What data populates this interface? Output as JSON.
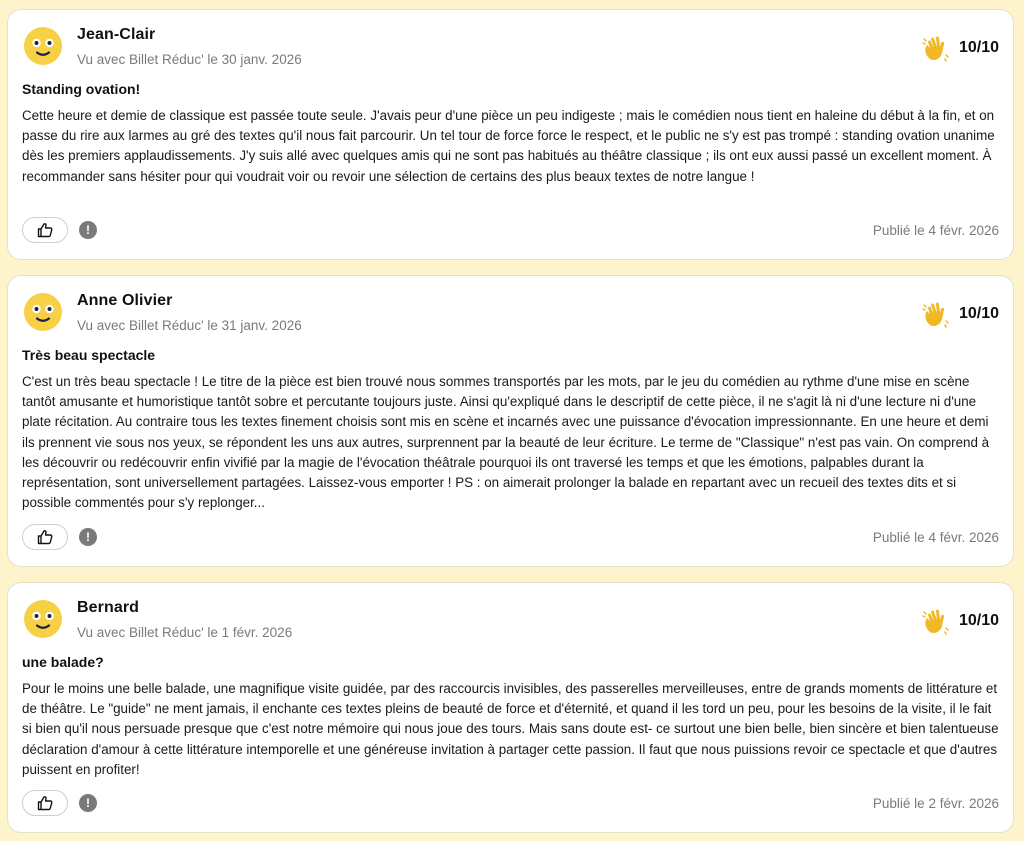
{
  "reviews": [
    {
      "name": "Jean-Clair",
      "meta": "Vu avec Billet Réduc' le 30 janv. 2026",
      "score": "10/10",
      "title": "Standing ovation!",
      "body": "Cette heure et demie de classique est passée toute seule. J'avais peur d'une pièce un peu indigeste ; mais le comédien nous tient en haleine du début à la fin, et on passe du rire aux larmes au gré des textes qu'il nous fait parcourir. Un tel tour de force force le respect, et le public ne s'y est pas trompé : standing ovation unanime dès les premiers applaudissements. J'y suis allé avec quelques amis qui ne sont pas habitués au théâtre classique ; ils ont eux aussi passé un excellent moment. À recommander sans hésiter pour qui voudrait voir ou revoir une sélection de certains des plus beaux textes de notre langue !",
      "published": "Publié le 4 févr. 2026"
    },
    {
      "name": "Anne Olivier",
      "meta": "Vu avec Billet Réduc' le 31 janv. 2026",
      "score": "10/10",
      "title": "Très beau spectacle",
      "body": "C'est un très beau spectacle ! Le titre de la pièce est bien trouvé nous sommes transportés par les mots, par le jeu du comédien au rythme d'une mise en scène tantôt amusante et humoristique tantôt sobre et percutante toujours juste. Ainsi qu'expliqué dans le descriptif de cette pièce, il ne s'agit là ni d'une lecture ni d'une plate récitation. Au contraire tous les textes finement choisis sont mis en scène et incarnés avec une puissance d'évocation impressionnante. En une heure et demi ils prennent vie sous nos yeux, se répondent les uns aux autres, surprennent par la beauté de leur écriture. Le terme de \"Classique\" n'est pas vain. On comprend à les découvrir ou redécouvrir enfin vivifié par la magie de l'évocation théâtrale pourquoi ils ont traversé les temps et que les émotions, palpables durant la représentation, sont universellement partagées. Laissez-vous emporter ! PS : on aimerait prolonger la balade en repartant avec un recueil des textes dits et si possible commentés pour s'y replonger...",
      "published": "Publié le 4 févr. 2026"
    },
    {
      "name": "Bernard",
      "meta": "Vu avec Billet Réduc' le 1 févr. 2026",
      "score": "10/10",
      "title": "une balade?",
      "body": "Pour le moins une belle balade, une magnifique visite guidée, par des raccourcis invisibles, des passerelles merveilleuses, entre de grands moments de littérature et de théâtre. Le \"guide\" ne ment jamais, il enchante ces textes pleins de beauté de force et d'éternité, et quand il les tord un peu, pour les besoins de la visite, il le fait si bien qu'il nous persuade presque que c'est notre mémoire qui nous joue des tours. Mais sans doute est- ce surtout une bien belle, bien sincère et bien talentueuse déclaration d'amour à cette littérature intemporelle et une généreuse invitation à partager cette passion. Il faut que nous puissions revoir ce spectacle et que d'autres puissent en profiter!",
      "published": "Publié le 2 févr. 2026"
    }
  ],
  "icons": {
    "avatar": "smiley-avatar-icon",
    "rating": "waving-hand-icon",
    "like": "thumbs-up-icon",
    "report": "exclamation-icon"
  },
  "report_glyph": "!",
  "colors": {
    "background": "#fdf4cc",
    "card": "#ffffff",
    "avatar": "#f7d046",
    "wave": "#f2b824",
    "muted_text": "#7a7a7a"
  }
}
